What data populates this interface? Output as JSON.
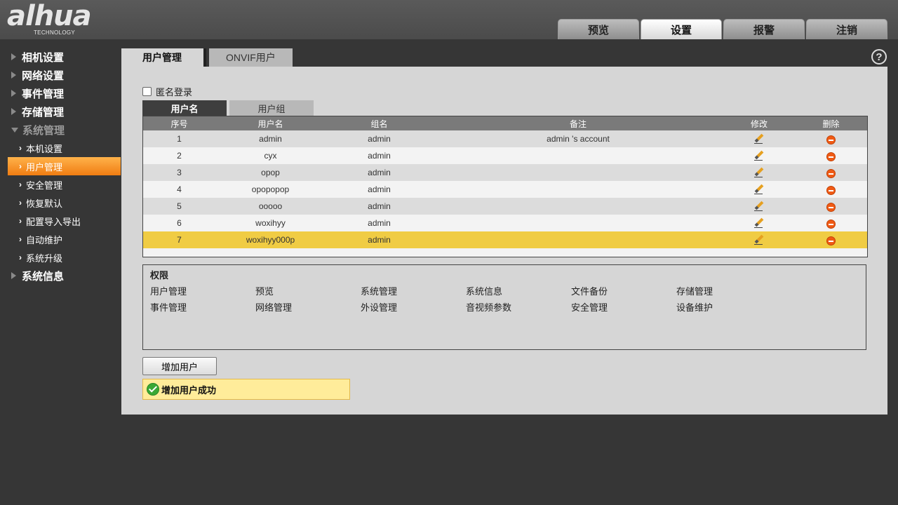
{
  "brand": {
    "logo": "alhua",
    "sub": "TECHNOLOGY"
  },
  "top_tabs": [
    "预览",
    "设置",
    "报警",
    "注销"
  ],
  "sidebar": {
    "main_top": [
      "相机设置",
      "网络设置",
      "事件管理",
      "存储管理"
    ],
    "open_group": "系统管理",
    "sub_items": [
      "本机设置",
      "用户管理",
      "安全管理",
      "恢复默认",
      "配置导入导出",
      "自动维护",
      "系统升级"
    ],
    "main_bottom": [
      "系统信息"
    ]
  },
  "main_tabs": [
    "用户管理",
    "ONVIF用户"
  ],
  "help": "?",
  "anonymous_login": {
    "label": "匿名登录",
    "checked": false
  },
  "sub_tabs": [
    "用户名",
    "用户组"
  ],
  "table": {
    "headers": [
      "序号",
      "用户名",
      "组名",
      "备注",
      "修改",
      "删除"
    ],
    "rows": [
      {
        "no": "1",
        "name": "admin",
        "group": "admin",
        "note": "admin 's account"
      },
      {
        "no": "2",
        "name": "cyx",
        "group": "admin",
        "note": ""
      },
      {
        "no": "3",
        "name": "opop",
        "group": "admin",
        "note": ""
      },
      {
        "no": "4",
        "name": "opopopop",
        "group": "admin",
        "note": ""
      },
      {
        "no": "5",
        "name": "ooooo",
        "group": "admin",
        "note": ""
      },
      {
        "no": "6",
        "name": "woxihyy",
        "group": "admin",
        "note": ""
      },
      {
        "no": "7",
        "name": "woxihyy000p",
        "group": "admin",
        "note": ""
      }
    ],
    "selected_row": 7
  },
  "permissions": {
    "title": "权限",
    "items": [
      "用户管理",
      "预览",
      "系统管理",
      "系统信息",
      "文件备份",
      "存储管理",
      "事件管理",
      "网络管理",
      "外设管理",
      "音视频参数",
      "安全管理",
      "设备维护"
    ]
  },
  "add_user_button": "增加用户",
  "message": "增加用户成功",
  "colors": {
    "accent": "#f07d12",
    "selected_row": "#f0cc44",
    "message_bg": "#ffec9a"
  }
}
